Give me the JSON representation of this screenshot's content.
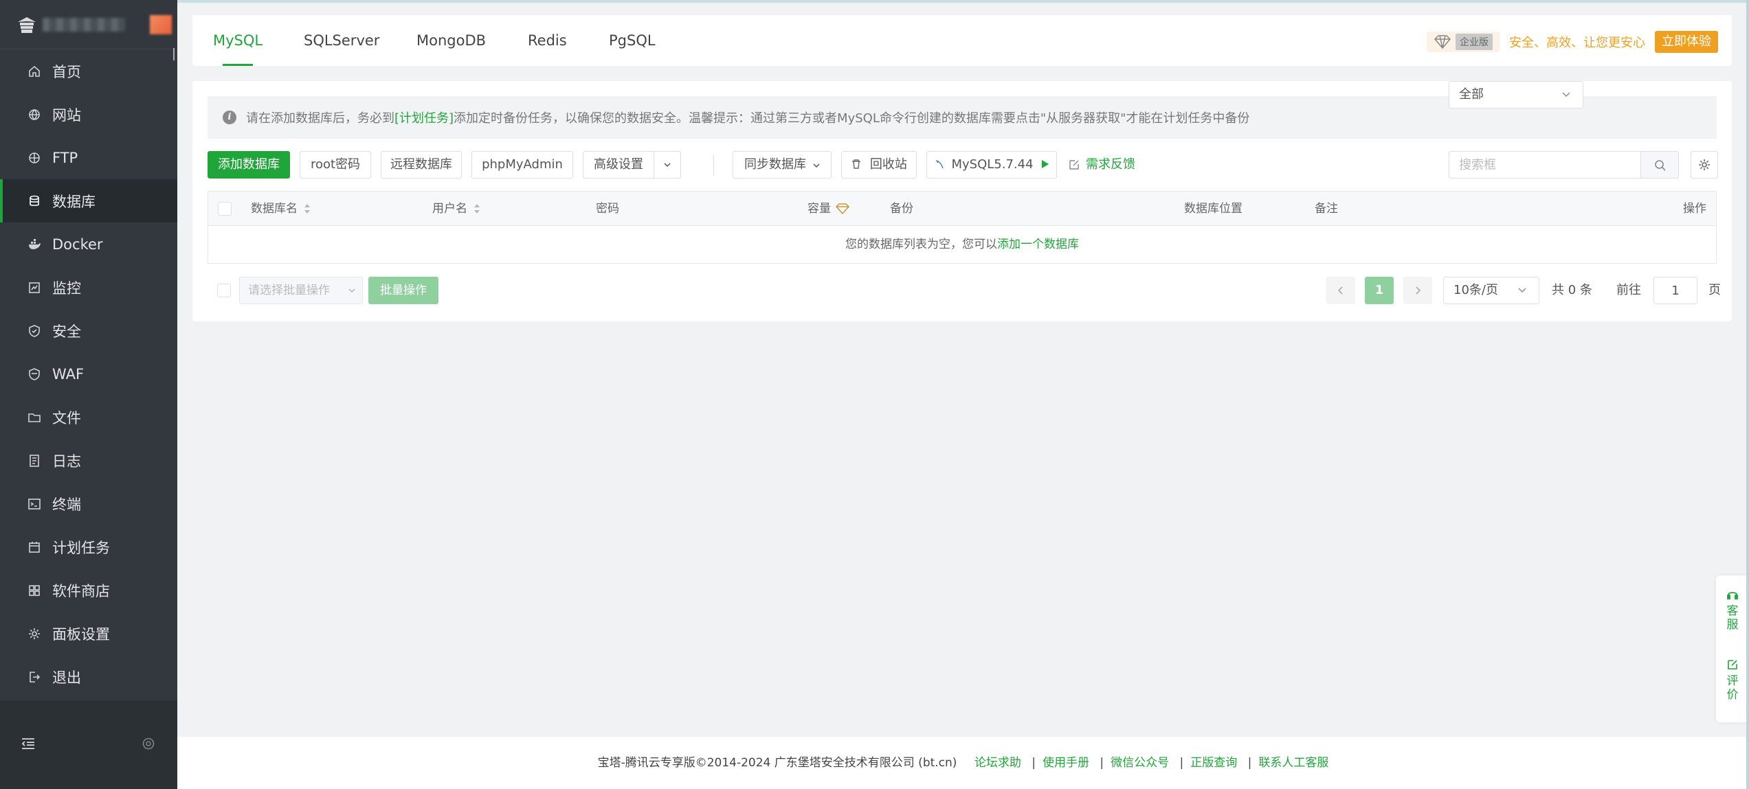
{
  "sidebar": {
    "items": [
      {
        "label": "首页",
        "icon": "home-icon"
      },
      {
        "label": "网站",
        "icon": "globe-icon"
      },
      {
        "label": "FTP",
        "icon": "ftp-icon"
      },
      {
        "label": "数据库",
        "icon": "database-icon",
        "active": true
      },
      {
        "label": "Docker",
        "icon": "docker-icon"
      },
      {
        "label": "监控",
        "icon": "monitor-icon"
      },
      {
        "label": "安全",
        "icon": "shield-icon"
      },
      {
        "label": "WAF",
        "icon": "waf-shield-icon"
      },
      {
        "label": "文件",
        "icon": "folder-icon"
      },
      {
        "label": "日志",
        "icon": "log-icon"
      },
      {
        "label": "终端",
        "icon": "terminal-icon"
      },
      {
        "label": "计划任务",
        "icon": "calendar-icon"
      },
      {
        "label": "软件商店",
        "icon": "apps-icon"
      },
      {
        "label": "面板设置",
        "icon": "gear-icon"
      },
      {
        "label": "退出",
        "icon": "logout-icon"
      }
    ]
  },
  "tabs": [
    {
      "label": "MySQL",
      "active": true
    },
    {
      "label": "SQLServer"
    },
    {
      "label": "MongoDB"
    },
    {
      "label": "Redis"
    },
    {
      "label": "PgSQL"
    }
  ],
  "promo": {
    "badge": "企业版",
    "text": "安全、高效、让您更安心",
    "button": "立即体验"
  },
  "notice": {
    "prefix": "请在添加数据库后，务必到",
    "link": "[计划任务]",
    "suffix": "添加定时备份任务，以确保您的数据安全。温馨提示：通过第三方或者MySQL命令行创建的数据库需要点击\"从服务器获取\"才能在计划任务中备份"
  },
  "toolbar": {
    "add_db": "添加数据库",
    "root_pwd": "root密码",
    "remote_db": "远程数据库",
    "phpmyadmin": "phpMyAdmin",
    "advanced": "高级设置",
    "sync_db": "同步数据库",
    "recycle": "回收站",
    "mysql_version": "MySQL5.7.44",
    "feedback": "需求反馈",
    "filter_value": "全部",
    "search_placeholder": "搜索框"
  },
  "table": {
    "headers": {
      "name": "数据库名",
      "user": "用户名",
      "password": "密码",
      "capacity": "容量",
      "backup": "备份",
      "location": "数据库位置",
      "remark": "备注",
      "action": "操作"
    },
    "empty_text": "您的数据库列表为空，您可以",
    "empty_link": "添加一个数据库"
  },
  "pagination": {
    "batch_placeholder": "请选择批量操作",
    "batch_button": "批量操作",
    "current_page": "1",
    "page_size": "10条/页",
    "total": "共 0 条",
    "goto_label": "前往",
    "goto_value": "1",
    "page_unit": "页"
  },
  "footer": {
    "copyright": "宝塔-腾讯云专享版©2014-2024 广东堡塔安全技术有限公司 (bt.cn)",
    "links": [
      "论坛求助",
      "使用手册",
      "微信公众号",
      "正版查询",
      "联系人工客服"
    ]
  },
  "float_panel": {
    "service_chars": [
      "客",
      "服"
    ],
    "review_chars": [
      "评",
      "价"
    ]
  },
  "colors": {
    "accent": "#20a53a",
    "sidebar_bg": "#32383e",
    "promo": "#f0a020"
  }
}
